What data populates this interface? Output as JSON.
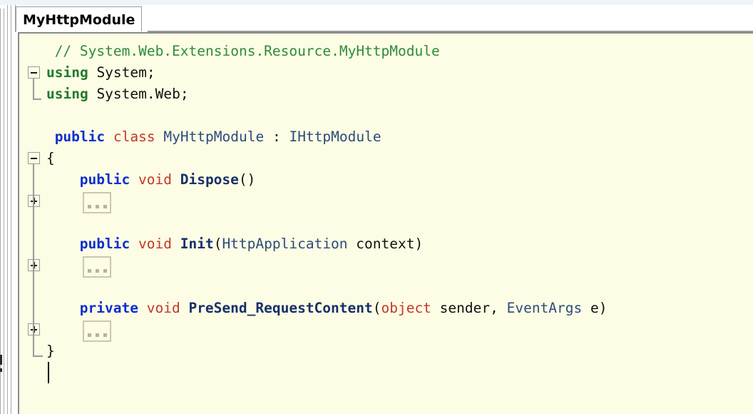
{
  "window": {
    "title": "MyHttpModule"
  },
  "tabs": [
    {
      "label": "MyHttpModule",
      "active": true
    }
  ],
  "editor": {
    "language": "C#",
    "background_color": "#fdfce4",
    "colors": {
      "comment": "#2e8b3d",
      "keyword_blue": "#0b2fcf",
      "keyword_green": "#1f7a2e",
      "keyword_red": "#c0392b",
      "type": "#2b4b7e",
      "method": "#17306b",
      "plain": "#111111",
      "fold_outline": "#9a9a9a",
      "collapsed_box_border": "#c9c9ad"
    },
    "lines": [
      {
        "n": 1,
        "indent": 1,
        "tokens": [
          {
            "t": "// System.Web.Extensions.Resource.MyHttpModule",
            "c": "cmt"
          }
        ]
      },
      {
        "n": 2,
        "indent": 0,
        "tokens": [
          {
            "t": "using",
            "c": "kwg"
          },
          {
            "t": " System;",
            "c": "pln"
          }
        ]
      },
      {
        "n": 3,
        "indent": 0,
        "tokens": [
          {
            "t": "using",
            "c": "kwg"
          },
          {
            "t": " System.Web;",
            "c": "pln"
          }
        ]
      },
      {
        "n": 4,
        "indent": 0,
        "tokens": []
      },
      {
        "n": 5,
        "indent": 1,
        "tokens": [
          {
            "t": "public",
            "c": "kw"
          },
          {
            "t": " ",
            "c": "pln"
          },
          {
            "t": "class",
            "c": "kwr"
          },
          {
            "t": " ",
            "c": "pln"
          },
          {
            "t": "MyHttpModule",
            "c": "typ"
          },
          {
            "t": " : ",
            "c": "pln"
          },
          {
            "t": "IHttpModule",
            "c": "typ"
          }
        ]
      },
      {
        "n": 6,
        "indent": 0,
        "tokens": [
          {
            "t": "{",
            "c": "pln"
          }
        ]
      },
      {
        "n": 7,
        "indent": 4,
        "tokens": [
          {
            "t": "public",
            "c": "kw"
          },
          {
            "t": " ",
            "c": "pln"
          },
          {
            "t": "void",
            "c": "kwr"
          },
          {
            "t": " ",
            "c": "pln"
          },
          {
            "t": "Dispose",
            "c": "mth"
          },
          {
            "t": "()",
            "c": "pln"
          }
        ]
      },
      {
        "n": 8,
        "indent": 4,
        "collapsed": true,
        "tokens": []
      },
      {
        "n": 9,
        "indent": 0,
        "tokens": []
      },
      {
        "n": 10,
        "indent": 4,
        "tokens": [
          {
            "t": "public",
            "c": "kw"
          },
          {
            "t": " ",
            "c": "pln"
          },
          {
            "t": "void",
            "c": "kwr"
          },
          {
            "t": " ",
            "c": "pln"
          },
          {
            "t": "Init",
            "c": "mth"
          },
          {
            "t": "(",
            "c": "pln"
          },
          {
            "t": "HttpApplication",
            "c": "typ"
          },
          {
            "t": " context)",
            "c": "pln"
          }
        ]
      },
      {
        "n": 11,
        "indent": 4,
        "collapsed": true,
        "tokens": []
      },
      {
        "n": 12,
        "indent": 0,
        "tokens": []
      },
      {
        "n": 13,
        "indent": 4,
        "tokens": [
          {
            "t": "private",
            "c": "kw"
          },
          {
            "t": " ",
            "c": "pln"
          },
          {
            "t": "void",
            "c": "kwr"
          },
          {
            "t": " ",
            "c": "pln"
          },
          {
            "t": "PreSend_RequestContent",
            "c": "mth"
          },
          {
            "t": "(",
            "c": "pln"
          },
          {
            "t": "object",
            "c": "kwr"
          },
          {
            "t": " sender, ",
            "c": "pln"
          },
          {
            "t": "EventArgs",
            "c": "typ"
          },
          {
            "t": " e)",
            "c": "pln"
          }
        ]
      },
      {
        "n": 14,
        "indent": 4,
        "collapsed": true,
        "tokens": []
      },
      {
        "n": 15,
        "indent": 0,
        "tokens": [
          {
            "t": "}",
            "c": "pln"
          }
        ]
      },
      {
        "n": 16,
        "indent": 0,
        "caret": true,
        "tokens": []
      }
    ],
    "fold_markers": [
      {
        "line": 2,
        "state": "expanded",
        "symbol": "minus"
      },
      {
        "line": 6,
        "state": "expanded",
        "symbol": "minus"
      },
      {
        "line": 8,
        "state": "collapsed",
        "symbol": "plus"
      },
      {
        "line": 11,
        "state": "collapsed",
        "symbol": "plus"
      },
      {
        "line": 14,
        "state": "collapsed",
        "symbol": "plus"
      }
    ]
  }
}
